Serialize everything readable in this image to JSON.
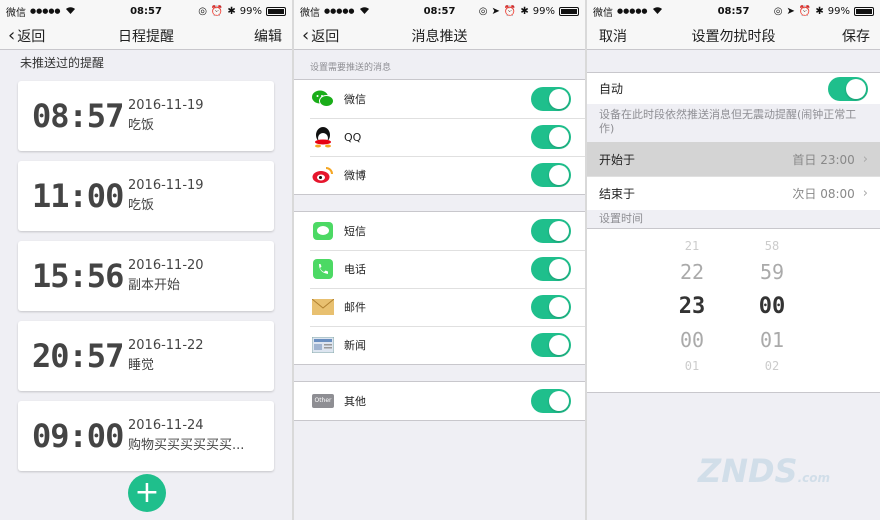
{
  "status": {
    "carrier": "微信",
    "signal": "●●●●●",
    "time": "08:57",
    "battery": "99%"
  },
  "screen1": {
    "nav": {
      "back": "返回",
      "title": "日程提醒",
      "right": "编辑"
    },
    "section": "未推送过的提醒",
    "reminders": [
      {
        "time": "08:57",
        "date": "2016-11-19",
        "label": "吃饭"
      },
      {
        "time": "11:00",
        "date": "2016-11-19",
        "label": "吃饭"
      },
      {
        "time": "15:56",
        "date": "2016-11-20",
        "label": "副本开始"
      },
      {
        "time": "20:57",
        "date": "2016-11-22",
        "label": "睡觉"
      },
      {
        "time": "09:00",
        "date": "2016-11-24",
        "label": "购物买买买买买买..."
      }
    ],
    "fab": "+"
  },
  "screen2": {
    "nav": {
      "back": "返回",
      "title": "消息推送"
    },
    "hint": "设置需要推送的消息",
    "group1": [
      {
        "icon": "wechat-icon",
        "label": "微信",
        "color": "#1aad19"
      },
      {
        "icon": "qq-icon",
        "label": "QQ",
        "color": "#000000"
      },
      {
        "icon": "weibo-icon",
        "label": "微博",
        "color": "#e6162d"
      }
    ],
    "group2": [
      {
        "icon": "sms-icon",
        "label": "短信",
        "color": "#4cd964"
      },
      {
        "icon": "phone-icon",
        "label": "电话",
        "color": "#4cd964"
      },
      {
        "icon": "mail-icon",
        "label": "邮件",
        "color": "#e0b050"
      },
      {
        "icon": "news-icon",
        "label": "新闻",
        "color": "#6a8fc0"
      }
    ],
    "group3": [
      {
        "icon": "other-icon",
        "label": "其他",
        "badge": "Other",
        "color": "#8e8e93"
      }
    ]
  },
  "screen3": {
    "nav": {
      "left": "取消",
      "title": "设置勿扰时段",
      "right": "保存"
    },
    "auto_label": "自动",
    "note": "设备在此时段依然推送消息但无震动提醒(闹钟正常工作)",
    "start": {
      "label": "开始于",
      "value": "首日 23:00"
    },
    "end": {
      "label": "结束于",
      "value": "次日 08:00"
    },
    "picker_title": "设置时间",
    "hours": [
      "21",
      "22",
      "23",
      "00",
      "01"
    ],
    "minutes": [
      "58",
      "59",
      "00",
      "01",
      "02"
    ]
  },
  "watermark": "ZNDS",
  "watermark_sub": ".com",
  "accent": "#1fbf8c"
}
